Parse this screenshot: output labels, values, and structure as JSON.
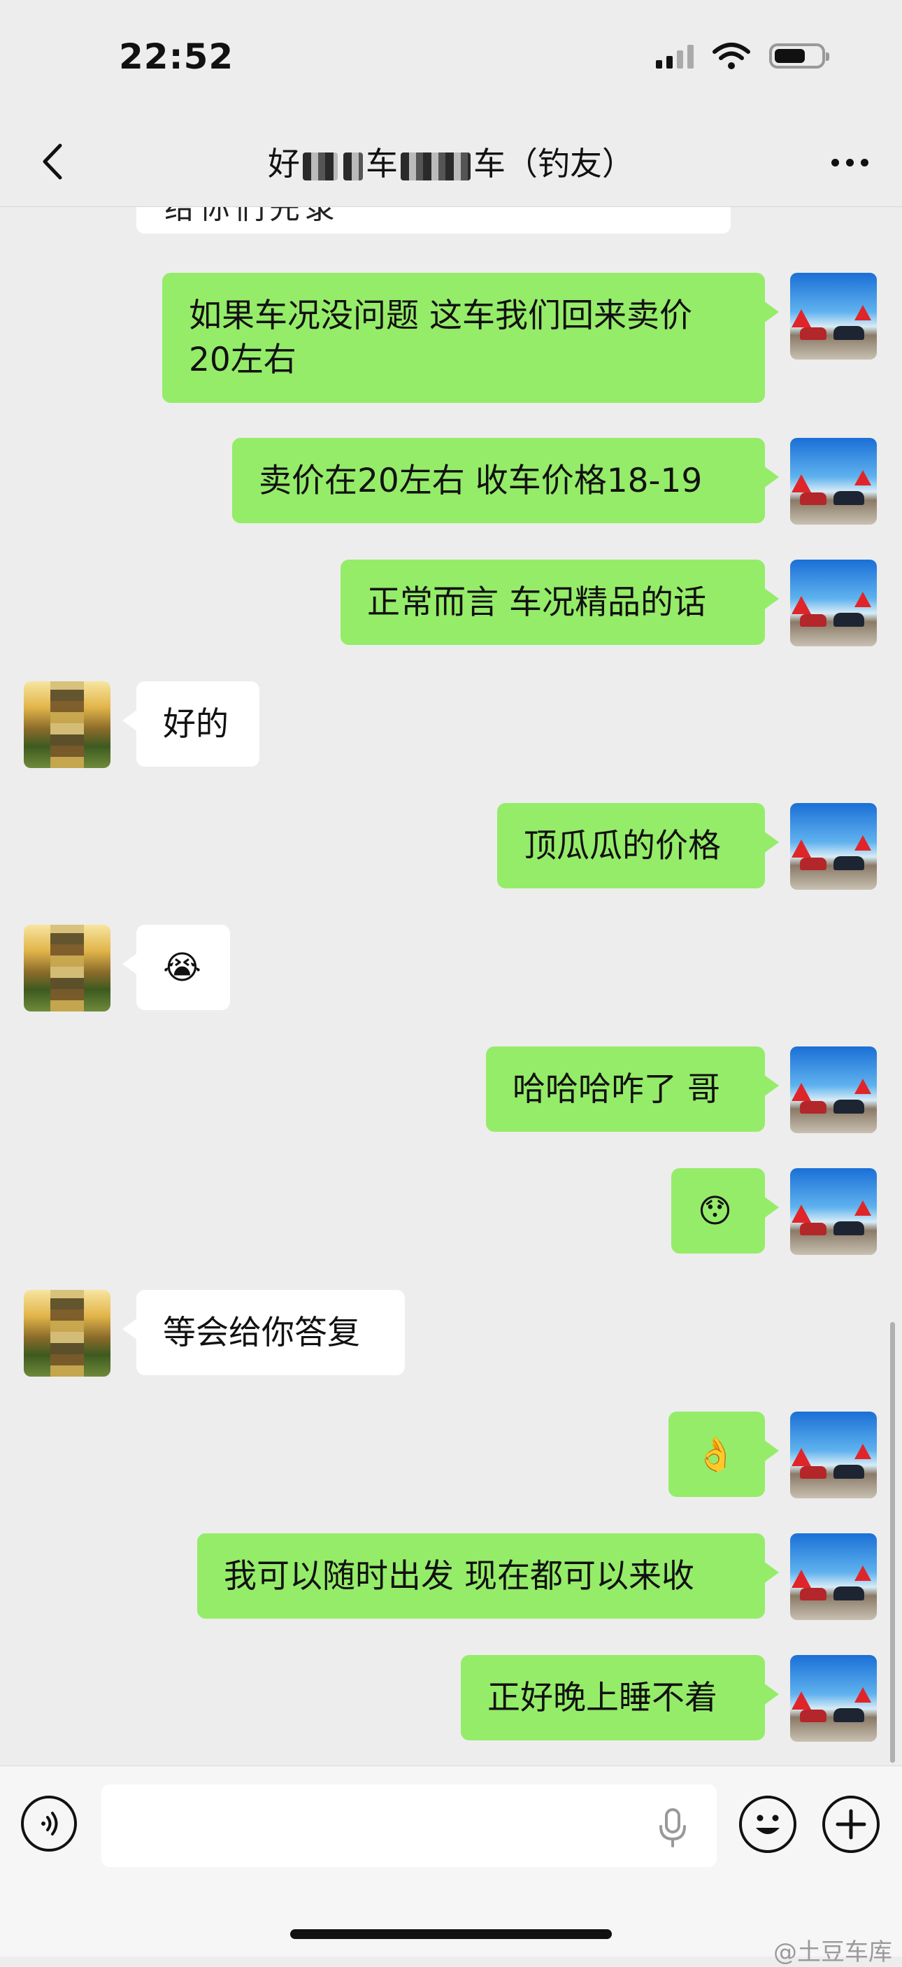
{
  "status_bar": {
    "time": "22:52",
    "battery_level": 0.6
  },
  "header": {
    "title_visible_1": "好",
    "title_visible_2": "车",
    "title_visible_3": "车",
    "title_suffix": "（钓友）",
    "back_icon": "chevron-left-icon",
    "more_icon": "more-dots-icon"
  },
  "partial_top": {
    "text": "给你们先录"
  },
  "messages": [
    {
      "side": "me",
      "lines": [
        "如果车况没问题 这车我们回来卖价",
        "20左右"
      ]
    },
    {
      "side": "me",
      "lines": [
        "卖价在20左右 收车价格18-19"
      ]
    },
    {
      "side": "me",
      "lines": [
        "正常而言 车况精品的话"
      ]
    },
    {
      "side": "them",
      "lines": [
        "好的"
      ]
    },
    {
      "side": "me",
      "lines": [
        "顶瓜瓜的价格"
      ]
    },
    {
      "side": "them",
      "lines": [
        "😭"
      ]
    },
    {
      "side": "me",
      "lines": [
        "哈哈哈咋了 哥"
      ]
    },
    {
      "side": "me",
      "lines": [
        "😯"
      ]
    },
    {
      "side": "them",
      "lines": [
        "等会给你答复"
      ]
    },
    {
      "side": "me",
      "lines": [
        "👌"
      ]
    },
    {
      "side": "me",
      "lines": [
        "我可以随时出发 现在都可以来收"
      ]
    },
    {
      "side": "me",
      "lines": [
        "正好晚上睡不着"
      ]
    }
  ],
  "input": {
    "voice_icon": "voice-icon",
    "mic_icon": "mic-icon",
    "emoji_icon": "smile-icon",
    "plus_icon": "plus-icon"
  },
  "watermark": "@土豆车库",
  "colors": {
    "me_bubble": "#95ec69",
    "them_bubble": "#ffffff",
    "background": "#ededed"
  }
}
